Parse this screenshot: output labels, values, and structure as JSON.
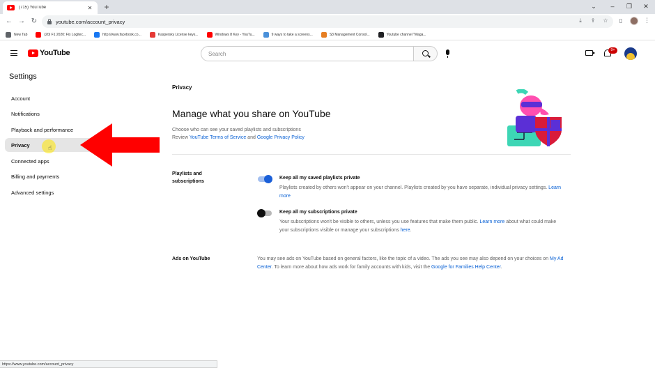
{
  "browser": {
    "tab_title": "(715) YouTube",
    "url": "youtube.com/account_privacy",
    "bookmarks": [
      {
        "label": "New Tab",
        "color": "#5f6368"
      },
      {
        "label": "(20) F1 2020: Fix Logitec...",
        "color": "#ff0000"
      },
      {
        "label": "http://www.facebook.co...",
        "color": "#1877f2"
      },
      {
        "label": "Kaspersky License keys...",
        "color": "#e53935"
      },
      {
        "label": "Windows 8 Key - YouTu...",
        "color": "#ff0000"
      },
      {
        "label": "9 ways to take a screens...",
        "color": "#4a90d9"
      },
      {
        "label": "S3 Management Consol...",
        "color": "#e67e22"
      },
      {
        "label": "Youtube channel \"Maga...",
        "color": "#202124"
      }
    ],
    "status_url": "https://www.youtube.com/account_privacy"
  },
  "masthead": {
    "logo_text": "YouTube",
    "search_placeholder": "Search",
    "notification_count": "9+"
  },
  "sidebar": {
    "title": "Settings",
    "items": [
      {
        "label": "Account"
      },
      {
        "label": "Notifications"
      },
      {
        "label": "Playback and performance"
      },
      {
        "label": "Privacy",
        "active": true
      },
      {
        "label": "Connected apps"
      },
      {
        "label": "Billing and payments"
      },
      {
        "label": "Advanced settings"
      }
    ]
  },
  "main": {
    "section_title": "Privacy",
    "headline": "Manage what you share on YouTube",
    "subtext_line1": "Choose who can see your saved playlists and subscriptions",
    "review_prefix": "Review ",
    "tos_link": "YouTube Terms of Service",
    "and_text": " and ",
    "privacy_link": "Google Privacy Policy",
    "playlists_label_1": "Playlists and",
    "playlists_label_2": "subscriptions",
    "opt1_title": "Keep all my saved playlists private",
    "opt1_desc": "Playlists created by others won't appear on your channel. Playlists created by you have separate, individual privacy settings.",
    "opt1_link": "Learn more",
    "opt1_on": true,
    "opt2_title": "Keep all my subscriptions private",
    "opt2_desc": "Your subscriptions won't be visible to others, unless you use features that make them public.",
    "opt2_link1": "Learn more",
    "opt2_mid": " about what could make your subscriptions visible or manage your subscriptions ",
    "opt2_link2": "here",
    "opt2_on": false,
    "ads_label": "Ads on YouTube",
    "ads_text1": "You may see ads on YouTube based on general factors, like the topic of a video. The ads you see may also depend on your choices on ",
    "ads_link1": "My Ad Center",
    "ads_text2": ". To learn more about how ads work for family accounts with kids, visit the ",
    "ads_link2": "Google for Families Help Center",
    "ads_text3": "."
  },
  "colors": {
    "link": "#065fd4",
    "toggle_on": "#1a5fd8",
    "annotation_arrow": "#ff0000",
    "youtube_red": "#ff0000"
  }
}
